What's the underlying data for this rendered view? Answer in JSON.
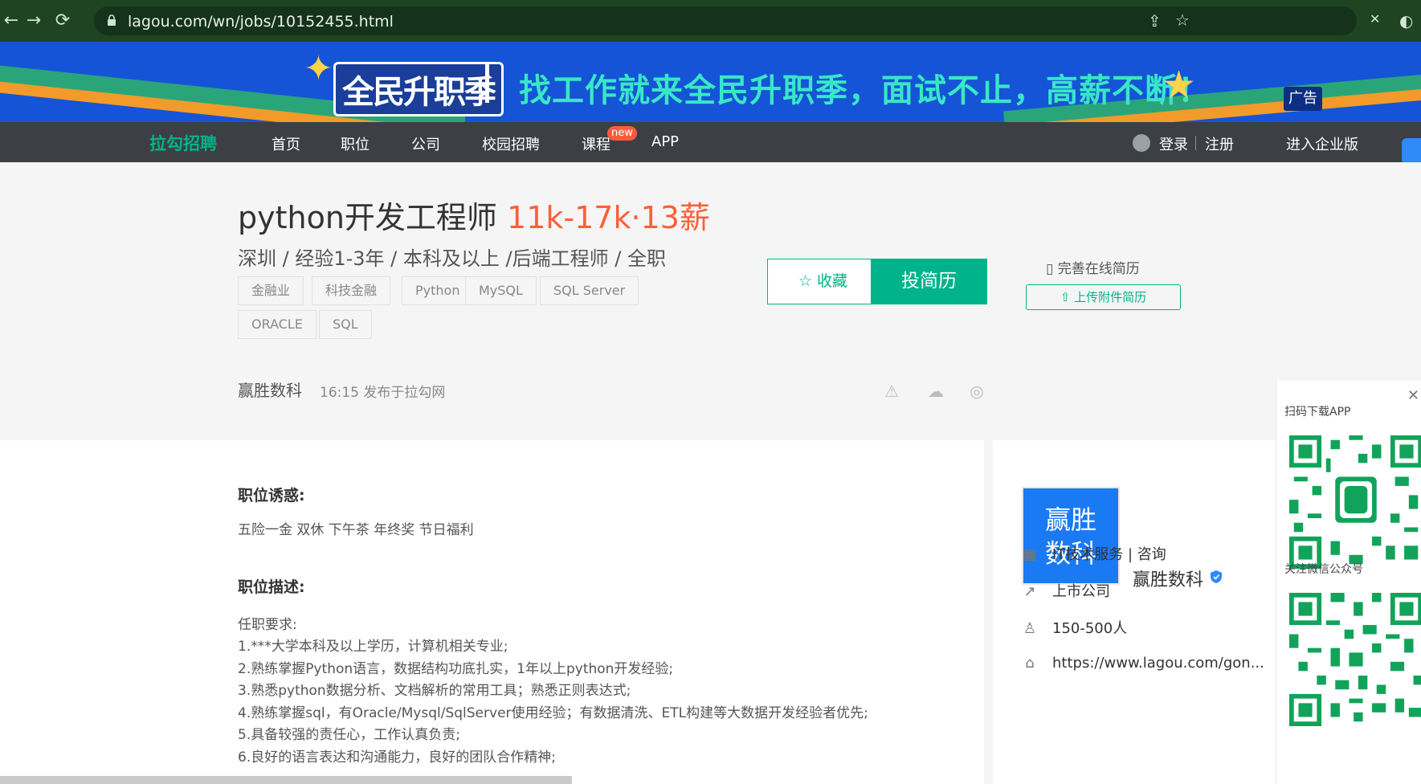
{
  "browser": {
    "url": "lagou.com/wn/jobs/10152455.html"
  },
  "banner": {
    "logo_text": "全民升职季",
    "slogan": "找工作就来全民升职季，面试不止，高薪不断！",
    "ad_label": "广告"
  },
  "nav": {
    "brand": "拉勾招聘",
    "items": [
      "首页",
      "职位",
      "公司",
      "校园招聘",
      "课程",
      "APP"
    ],
    "new_badge": "new",
    "login": "登录",
    "register": "注册",
    "enterprise": "进入企业版"
  },
  "job": {
    "title": "python开发工程师",
    "salary": "11k-17k·13薪",
    "subinfo": "深圳 / 经验1-3年 / 本科及以上 /后端工程师 / 全职",
    "tags": [
      "金融业",
      "科技金融",
      "Python",
      "MySQL",
      "SQL Server",
      "ORACLE",
      "SQL"
    ],
    "collect_label": "收藏",
    "apply_label": "投简历",
    "resume_link": "完善在线简历",
    "upload_label": "上传附件简历",
    "company": "赢胜数科",
    "published": "16:15  发布于拉勾网"
  },
  "content": {
    "benefit_title": "职位诱惑:",
    "benefit": "五险一金 双休 下午茶 年终奖 节日福利",
    "desc_title": "职位描述:",
    "desc_lines": [
      "任职要求:",
      "1.***大学本科及以上学历，计算机相关专业;",
      "2.熟练掌握Python语言，数据结构功底扎实，1年以上python开发经验;",
      "3.熟悉python数据分析、文档解析的常用工具；熟悉正则表达式;",
      "4.熟练掌握sql，有Oracle/Mysql/SqlServer使用经验；有数据清洗、ETL构建等大数据开发经验者优先;",
      "5.具备较强的责任心，工作认真负责;",
      "6.良好的语言表达和沟通能力，良好的团队合作精神;"
    ]
  },
  "company": {
    "logo_line1": "赢胜",
    "logo_line2": "数科",
    "name": "赢胜数科",
    "industry": "IT技术服务 | 咨询",
    "stage": "上市公司",
    "size": "150-500人",
    "website": "https://www.lagou.com/gon..."
  },
  "qr": {
    "app_title": "扫码下载APP",
    "wechat_title": "关注微信公众号"
  },
  "colors": {
    "accent": "#00b38a",
    "salary": "#fd5f39",
    "banner": "#1554d6"
  }
}
